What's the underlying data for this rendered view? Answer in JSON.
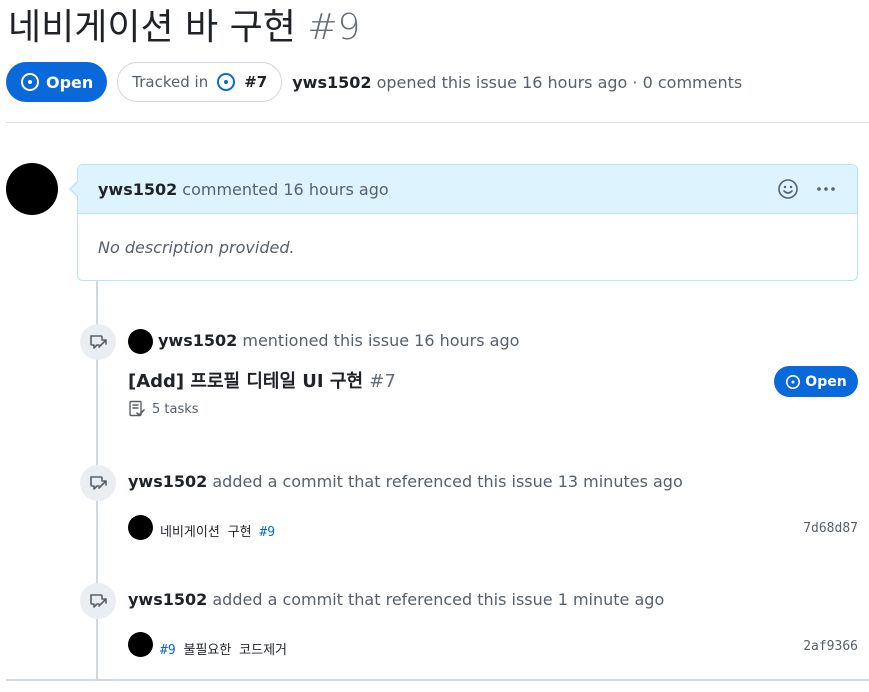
{
  "issue": {
    "title": "네비게이션 바 구현",
    "number": "#9",
    "state_label": "Open",
    "tracked_prefix": "Tracked in",
    "tracked_number": "#7",
    "author": "yws1502",
    "opened_text": "opened this issue 16 hours ago · 0 comments"
  },
  "comment": {
    "author": "yws1502",
    "meta": "commented 16 hours ago",
    "body": "No description provided."
  },
  "timeline": {
    "mention": {
      "author": "yws1502",
      "text": "mentioned this issue 16 hours ago",
      "ref_title": "[Add] 프로필 디테일 UI 구현",
      "ref_number": "#7",
      "tasks": "5 tasks",
      "state_label": "Open"
    },
    "commit1": {
      "author": "yws1502",
      "text": "added a commit that referenced this issue 13 minutes ago",
      "message": "네비게이션 구현",
      "issue_link": "#9",
      "sha": "7d68d87"
    },
    "commit2": {
      "author": "yws1502",
      "text": "added a commit that referenced this issue 1 minute ago",
      "issue_link": "#9",
      "message": "불필요한 코드제거",
      "sha": "2af9366"
    }
  },
  "colors": {
    "accent": "#0969da",
    "comment_header_bg": "#ddf4ff",
    "comment_border": "#b6e3ff",
    "muted_text": "#57606a"
  },
  "icons": {
    "state_icon": "issue-opened-icon",
    "cross_reference_icon": "cross-reference-icon",
    "smiley_icon": "smiley-icon",
    "kebab_icon": "kebab-horizontal-icon",
    "tasklist_icon": "tasklist-icon"
  }
}
